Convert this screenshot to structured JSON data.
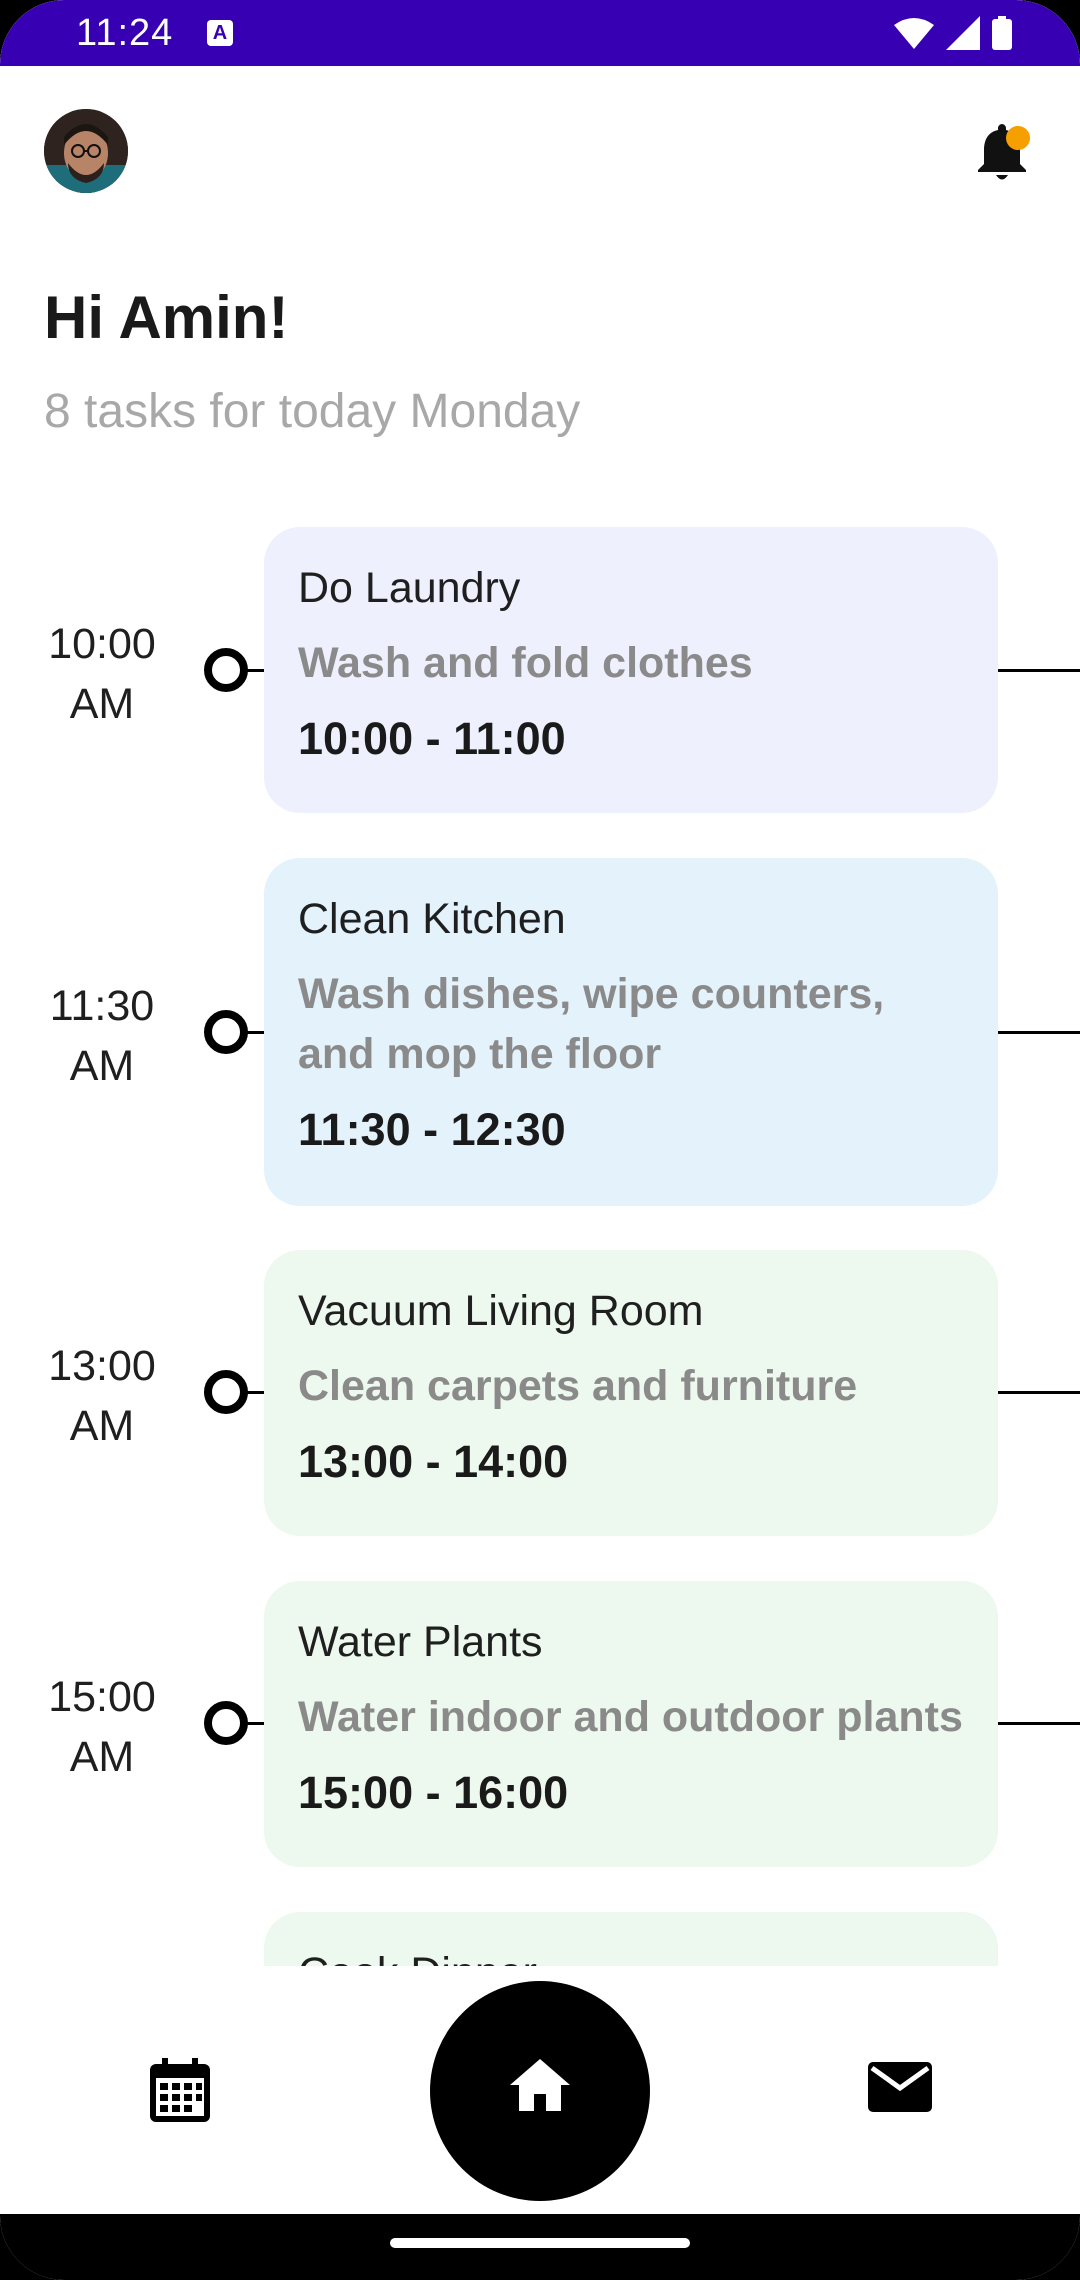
{
  "status_bar": {
    "time": "11:24",
    "indicator": "A"
  },
  "header": {
    "avatar_alt": "",
    "notification_icon": "bell-icon",
    "has_notification_dot": true
  },
  "greeting": {
    "title": "Hi Amin!",
    "subtitle": "8 tasks for today Monday"
  },
  "tasks": [
    {
      "time_label": "10:00\nAM",
      "title": "Do Laundry",
      "description": "Wash and fold clothes",
      "range": "10:00 - 11:00",
      "color": "#eef0fd"
    },
    {
      "time_label": "11:30\nAM",
      "title": "Clean Kitchen",
      "description": "Wash dishes, wipe counters, and mop the floor",
      "range": "11:30 - 12:30",
      "color": "#e3f2fb"
    },
    {
      "time_label": "13:00\nAM",
      "title": "Vacuum Living Room",
      "description": "Clean carpets and furniture",
      "range": "13:00 - 14:00",
      "color": "#edf8ee"
    },
    {
      "time_label": "15:00\nAM",
      "title": "Water Plants",
      "description": "Water indoor and outdoor plants",
      "range": "15:00 - 16:00",
      "color": "#edf8ee"
    },
    {
      "time_label": "",
      "title": "Cook Dinner",
      "description": "",
      "range": "",
      "color": "#edf8ee"
    }
  ],
  "bottom_nav": {
    "items": [
      {
        "icon": "calendar-icon"
      },
      {
        "icon": "home-icon",
        "active": true
      },
      {
        "icon": "mail-icon"
      }
    ]
  },
  "colors": {
    "status_bar": "#3700b3",
    "notification_dot": "#f5a000"
  }
}
